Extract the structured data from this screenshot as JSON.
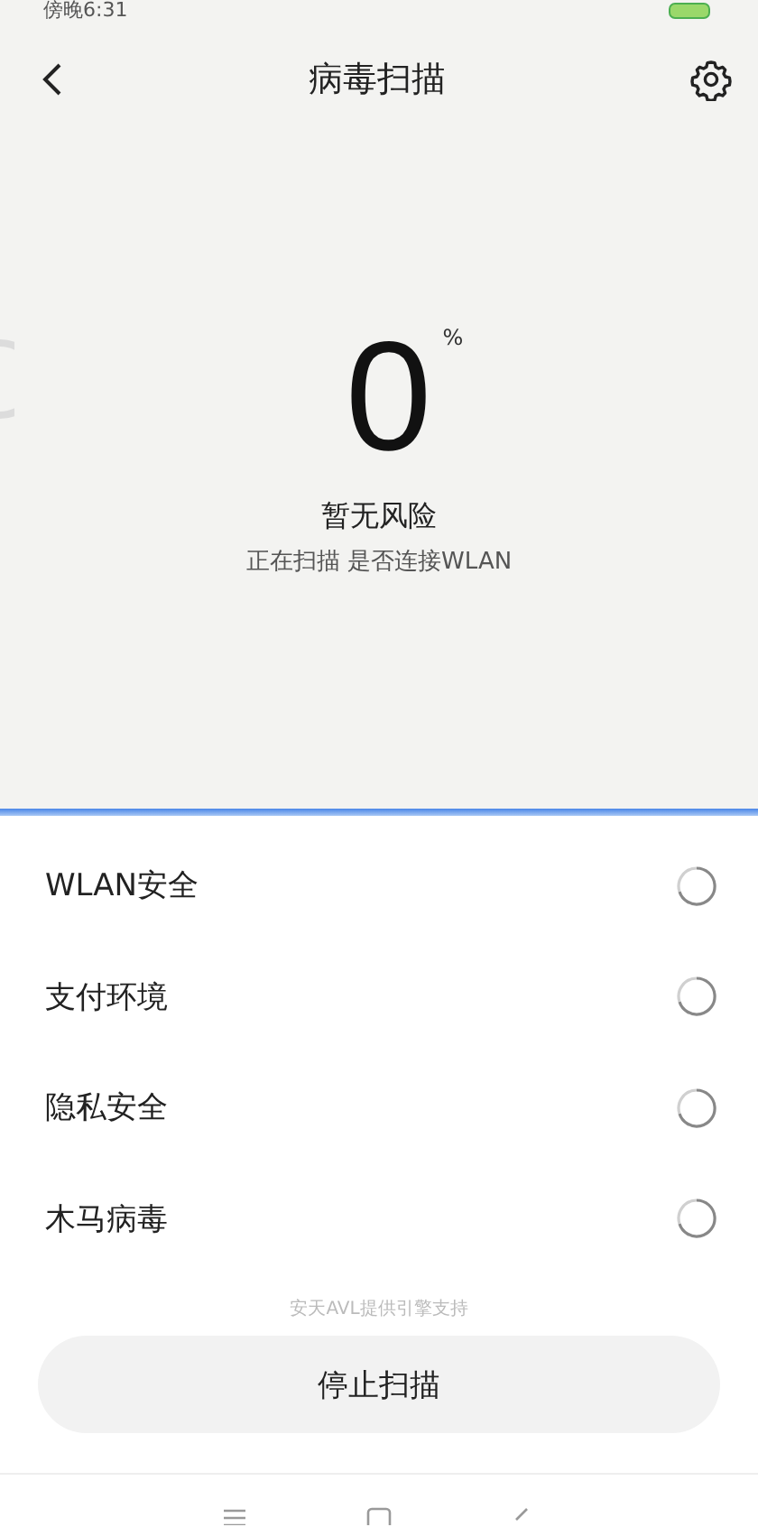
{
  "status_bar": {
    "time": "傍晚6:31"
  },
  "header": {
    "title": "病毒扫描"
  },
  "progress": {
    "value": "0",
    "unit": "%",
    "status": "暂无风险",
    "detail": "正在扫描 是否连接WLAN"
  },
  "checks": [
    {
      "label": "WLAN安全"
    },
    {
      "label": "支付环境"
    },
    {
      "label": "隐私安全"
    },
    {
      "label": "木马病毒"
    }
  ],
  "engine_note": "安天AVL提供引擎支持",
  "stop_button": "停止扫描"
}
